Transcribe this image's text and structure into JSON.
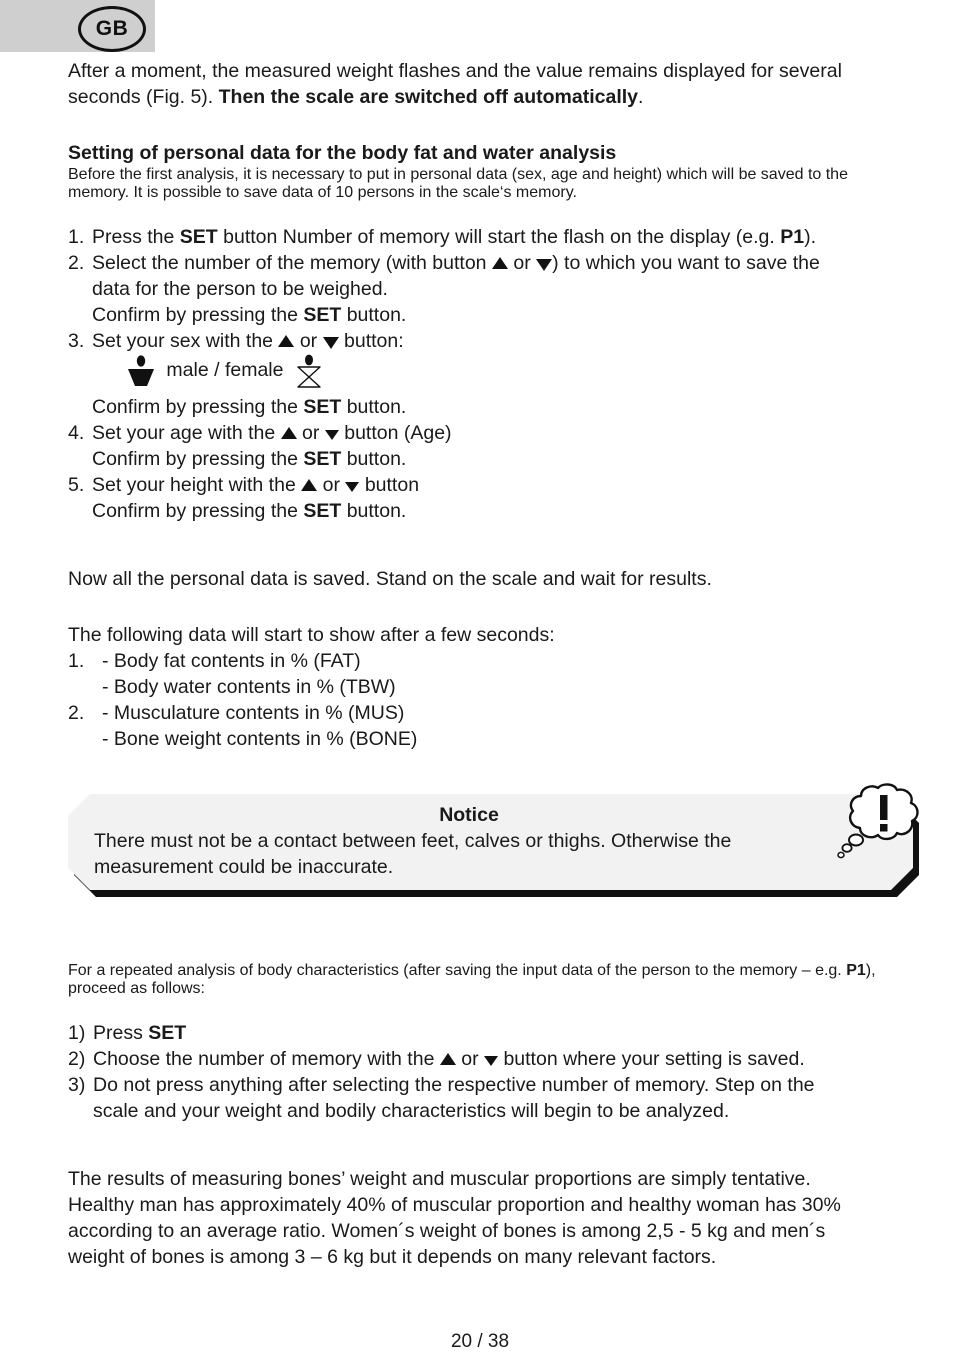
{
  "header": {
    "badge_label": "GB"
  },
  "intro": {
    "line1_plain": "After a moment, the measured weight flashes and the value remains displayed for several",
    "line2_plain": "seconds (Fig. 5). ",
    "line2_bold": "Then the scale are switched off automatically",
    "line2_end": "."
  },
  "section": {
    "heading": "Setting of personal data for the body fat and water analysis",
    "body": "Before the first analysis, it is necessary to put in personal data (sex, age and height) which will be saved to the memory. It is possible to save data of 10 persons in the scale‘s memory."
  },
  "steps": [
    {
      "marker": "1.",
      "text_a": "Press the ",
      "bold_a": "SET",
      "text_b": " button Number of memory will start the flash on the display (e.g. ",
      "bold_b": "P1",
      "text_c": ")."
    },
    {
      "marker": "2.",
      "text_a": "Select the number of the memory (with button ",
      "icon_up": "arrow-up-icon",
      "text_b": " or ",
      "icon_down": "arrow-down-icon",
      "text_c": ") to which you want to save the",
      "line2": "data for the person to be weighed.",
      "confirm_a": "Confirm by pressing the ",
      "confirm_bold": "SET",
      "confirm_b": " button."
    },
    {
      "marker": "3.",
      "text_a": "Set your sex with the ",
      "icon_up": "arrow-up-icon",
      "text_b": " or ",
      "icon_down": "arrow-down-icon",
      "text_c": " button:",
      "gender_label": "male / female",
      "confirm_a": "Confirm by pressing the ",
      "confirm_bold": "SET",
      "confirm_b": " button."
    },
    {
      "marker": "4.",
      "text_a": "Set your age with the ",
      "icon_up": "arrow-up-icon",
      "text_b": " or ",
      "icon_down": "arrow-down-icon",
      "text_c": " button (Age)",
      "confirm_a": "Confirm by pressing the ",
      "confirm_bold": "SET",
      "confirm_b": " button."
    },
    {
      "marker": "5.",
      "text_a": "Set your height with the ",
      "icon_up": "arrow-up-icon",
      "text_b": " or ",
      "icon_down": "arrow-down-icon",
      "text_c": " button",
      "confirm_a": "Confirm by pressing the ",
      "confirm_bold": "SET",
      "confirm_b": " button."
    }
  ],
  "saved_note": "Now all the personal data is saved. Stand on the scale and wait for results.",
  "results": {
    "intro": "The following data will start to show after a few seconds:",
    "items": [
      {
        "marker": "1.",
        "primary": "- Body fat contents in % (FAT)",
        "secondary": "- Body water contents in % (TBW)"
      },
      {
        "marker": "2.",
        "primary": "- Musculature contents in % (MUS)",
        "secondary": "- Bone weight contents in % (BONE)"
      }
    ]
  },
  "notice": {
    "title": "Notice",
    "line1": "There must not be a contact between feet, calves or thighs. Otherwise the",
    "line2": "measurement could be inaccurate.",
    "bubble_glyph": "!",
    "bubble_icon": "exclamation-thought-bubble-icon"
  },
  "repeat": {
    "intro_a": "For a repeated analysis of body characteristics (after saving the input data of the person to the memory – e.g. ",
    "intro_bold": "P1",
    "intro_b": "), proceed as follows:",
    "steps": [
      {
        "marker": "1)",
        "text_a": "Press ",
        "bold_a": "SET",
        "text_b": ""
      },
      {
        "marker": "2)",
        "text_a": "Choose the number of memory with the ",
        "icon_up": "arrow-up-icon",
        "text_b": " or ",
        "icon_down": "arrow-down-icon",
        "text_c": " button where your setting is saved."
      },
      {
        "marker": "3)",
        "text_a": "Do not press anything after selecting the respective number of memory. Step on the",
        "line2": "scale and your weight and bodily characteristics will begin to be analyzed."
      }
    ]
  },
  "closing": {
    "line1": "The results of measuring bones’ weight and muscular proportions are simply tentative.",
    "line2": "Healthy man has approximately 40% of muscular proportion and healthy woman has 30%",
    "line3": "according to an average ratio. Women´s weight of bones is among 2,5 - 5 kg and men´s",
    "line4": "weight of bones is among 3 – 6 kg but it depends on many relevant factors."
  },
  "footer": {
    "page_label": "20 / 38"
  }
}
